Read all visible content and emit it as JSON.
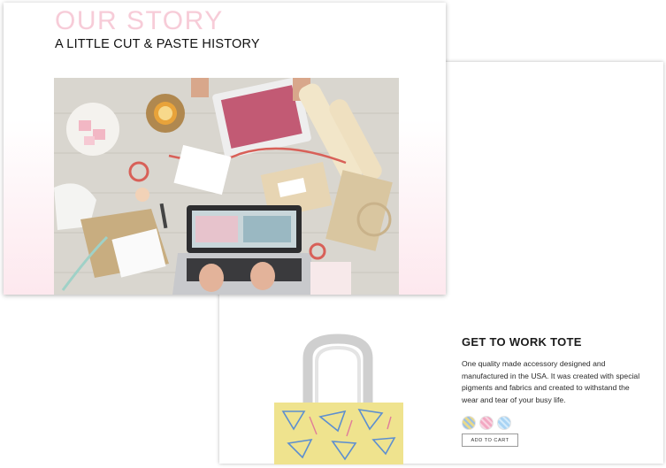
{
  "story": {
    "title": "OUR STORY",
    "subtitle": "A LITTLE CUT & PASTE HISTORY"
  },
  "product": {
    "title": "GET TO WORK TOTE",
    "description": "One quality made accessory designed and manufactured in the USA. It was created with special pigments and fabrics and created to withstand the wear and tear of your busy life.",
    "add_to_cart_label": "ADD TO CART",
    "swatches": [
      "#e8d98a",
      "#f2a8c2",
      "#a9d4f4"
    ]
  },
  "icons": [
    "backpack-image",
    "tote-bag-image",
    "workspace-photo"
  ]
}
